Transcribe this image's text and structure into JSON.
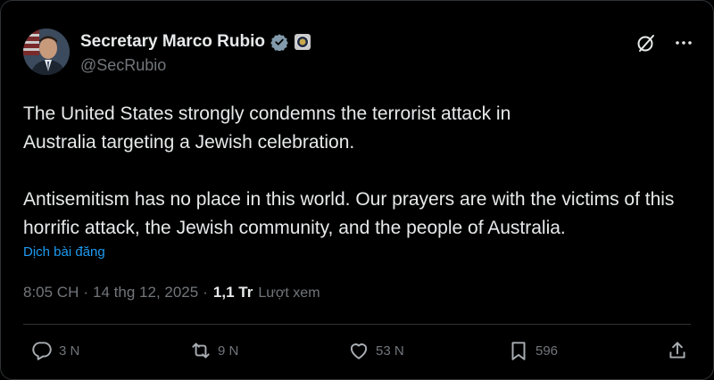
{
  "author": {
    "display_name": "Secretary Marco Rubio",
    "handle": "@SecRubio",
    "verified_badge_icon": "verified-check-icon",
    "affiliation_icon": "government-seal-icon"
  },
  "top_actions": {
    "grok_icon": "slash-circle-icon",
    "more_icon": "more-dots-icon"
  },
  "post": {
    "paragraphs": [
      "The United States strongly condemns the terrorist attack in Australia targeting a Jewish celebration.",
      "Antisemitism has no place in this world. Our prayers are with the victims of this horrific attack, the Jewish community, and the people of Australia."
    ],
    "translate_label": "Dịch bài đăng"
  },
  "meta": {
    "time": "8:05 CH",
    "separator": "·",
    "date": "14 thg 12, 2025",
    "views_count": "1,1 Tr",
    "views_label": "Lượt xem"
  },
  "stats": {
    "replies": "3 N",
    "reposts": "9 N",
    "likes": "53 N",
    "bookmarks": "596"
  },
  "colors": {
    "background": "#000000",
    "text": "#e7e9ea",
    "muted": "#71767b",
    "link": "#1d9bf0",
    "verified": "#829aab"
  }
}
